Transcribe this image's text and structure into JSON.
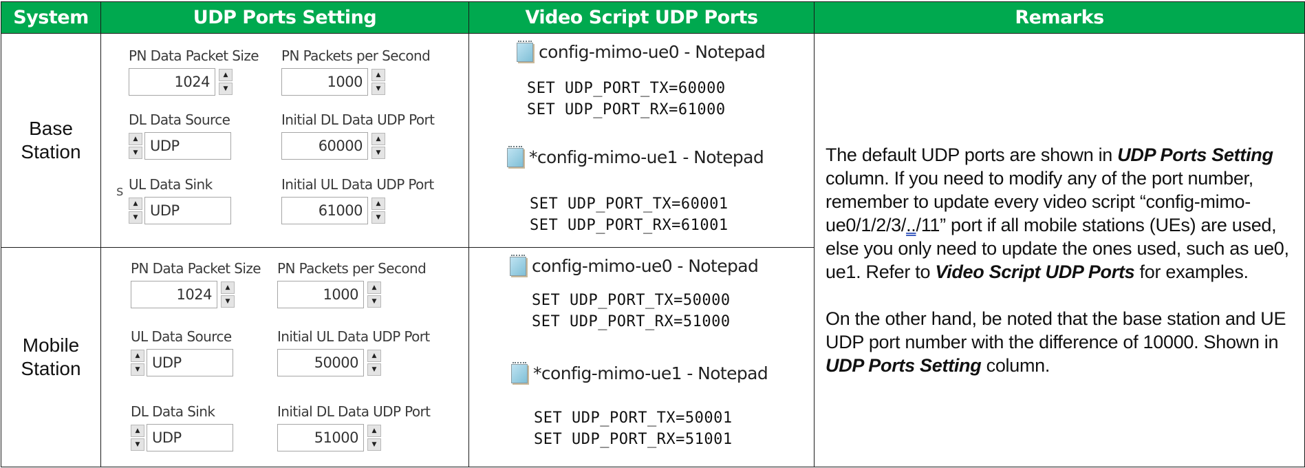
{
  "headers": [
    "System",
    "UDP Ports Setting",
    "Video Script UDP Ports",
    "Remarks"
  ],
  "colors": {
    "header_bg": "#00a94f",
    "header_text": "#ffffff"
  },
  "rows": [
    {
      "system": [
        "Base",
        "Station"
      ],
      "settings": {
        "stray_char": "s",
        "fields": [
          {
            "label": "PN Data Packet Size",
            "value": "1024",
            "kind": "number"
          },
          {
            "label": "PN Packets per Second",
            "value": "1000",
            "kind": "number"
          },
          {
            "label": "DL Data Source",
            "value": "UDP",
            "kind": "select"
          },
          {
            "label": "Initial DL Data UDP Port",
            "value": "60000",
            "kind": "number"
          },
          {
            "label": "UL Data Sink",
            "value": "UDP",
            "kind": "select"
          },
          {
            "label": "Initial UL Data UDP Port",
            "value": "61000",
            "kind": "number"
          }
        ]
      },
      "scripts": [
        {
          "icon": "notepad-icon",
          "title": "config-mimo-ue0 - Notepad",
          "lines": [
            "SET UDP_PORT_TX=60000",
            "SET UDP_PORT_RX=61000"
          ]
        },
        {
          "icon": "notepad-icon",
          "title": "*config-mimo-ue1 - Notepad",
          "lines": [
            "SET UDP_PORT_TX=60001",
            "SET UDP_PORT_RX=61001"
          ]
        }
      ]
    },
    {
      "system": [
        "Mobile",
        "Station"
      ],
      "settings": {
        "fields": [
          {
            "label": "PN Data Packet Size",
            "value": "1024",
            "kind": "number"
          },
          {
            "label": "PN Packets per Second",
            "value": "1000",
            "kind": "number"
          },
          {
            "label": "UL Data Source",
            "value": "UDP",
            "kind": "select"
          },
          {
            "label": "Initial UL Data UDP Port",
            "value": "50000",
            "kind": "number"
          },
          {
            "label": "DL Data Sink",
            "value": "UDP",
            "kind": "select"
          },
          {
            "label": "Initial DL Data UDP Port",
            "value": "51000",
            "kind": "number"
          }
        ]
      },
      "scripts": [
        {
          "icon": "notepad-icon",
          "title": "config-mimo-ue0 - Notepad",
          "lines": [
            "SET UDP_PORT_TX=50000",
            "SET UDP_PORT_RX=51000"
          ]
        },
        {
          "icon": "notepad-icon",
          "title": "*config-mimo-ue1 - Notepad",
          "lines": [
            "SET UDP_PORT_TX=50001",
            "SET UDP_PORT_RX=51001"
          ]
        }
      ]
    }
  ],
  "remarks": {
    "p1": {
      "t1": "The default UDP ports are shown in ",
      "b1": "UDP Ports Setting",
      "t2": " column. If you need to modify any of the port number, remember to update every video script “config-mimo-ue0/1/2/3/",
      "u1": "..",
      "t3": "/11” port if all mobile stations (UEs) are used, else you only need to update the ones used, such as ue0, ue1. Refer to ",
      "b2": "Video Script UDP Ports",
      "t4": " for examples."
    },
    "p2": {
      "t1": "On the other hand, be noted that the base station and UE UDP port number with the difference of 10000. Shown in ",
      "b1": "UDP Ports Setting",
      "t2": " column."
    }
  }
}
